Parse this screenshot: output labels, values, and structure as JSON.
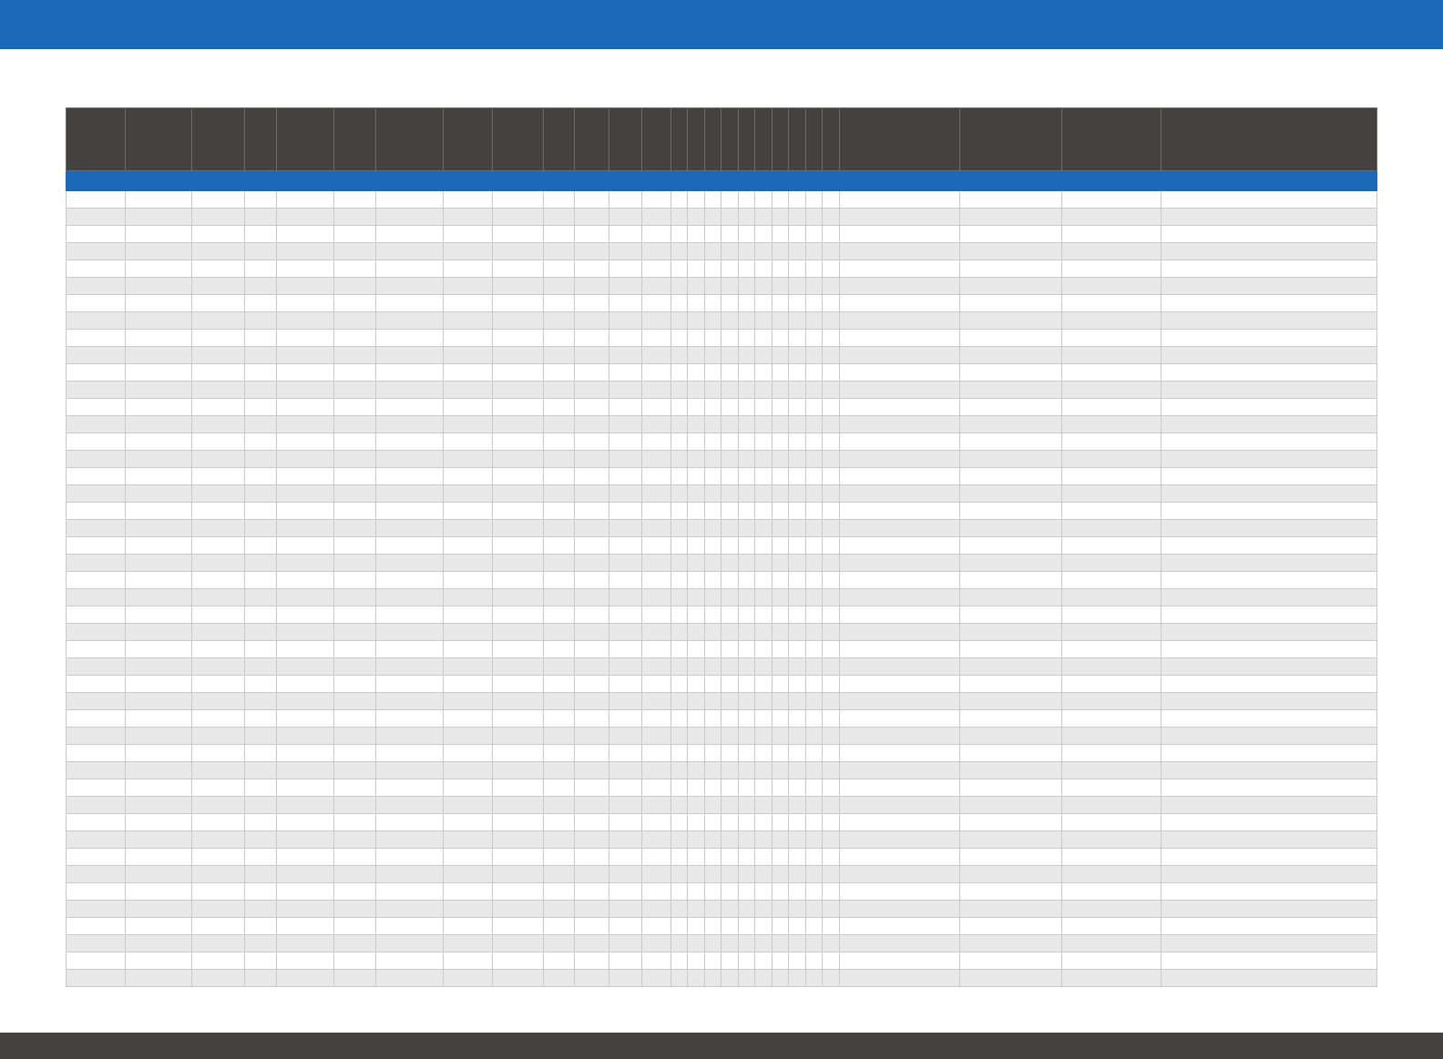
{
  "colors": {
    "top_banner": "#1c68b8",
    "bottom_banner": "#434241",
    "header_row": "#434241",
    "section_row": "#1c68b8",
    "row_odd": "#ffffff",
    "row_even": "#e8e8e8",
    "grid_line": "#c9c9c9"
  },
  "table": {
    "column_headers": [
      "",
      "",
      "",
      "",
      "",
      "",
      "",
      "",
      "",
      "",
      "",
      "",
      "",
      "",
      "",
      "",
      "",
      "",
      "",
      "",
      "",
      "",
      "",
      "",
      "",
      "",
      "",
      ""
    ],
    "section_label": "",
    "rows": []
  }
}
